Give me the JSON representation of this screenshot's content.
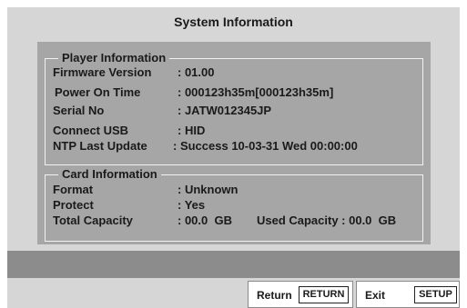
{
  "screen": {
    "title": "System Information"
  },
  "player_info": {
    "legend": "Player Information",
    "rows": [
      {
        "label": "Firmware Version",
        "value": ": 01.00"
      },
      {
        "label": "Power On Time",
        "value": ": 000123h35m[000123h35m]"
      },
      {
        "label": "Serial No",
        "value": ": JATW012345JP"
      },
      {
        "label": "Connect USB",
        "value": ": HID"
      },
      {
        "label": "NTP Last Update",
        "value": ": Success 10-03-31 Wed 00:00:00"
      }
    ]
  },
  "card_info": {
    "legend": "Card Information",
    "format": {
      "label": "Format",
      "value": ": Unknown"
    },
    "protect": {
      "label": "Protect",
      "value": ": Yes"
    },
    "total_capacity": {
      "label": "Total Capacity",
      "value": ": 00.0  GB"
    },
    "used_capacity": "Used Capacity : 00.0  GB"
  },
  "footer": {
    "return_label": "Return",
    "return_key": "RETURN",
    "exit_label": "Exit",
    "exit_key": "SETUP"
  },
  "colors": {
    "screen_background": "#d6d6d6",
    "panel_background": "#a6a6a6",
    "status_bar": "#8c8c8c",
    "group_border": "#f2f2f2"
  }
}
